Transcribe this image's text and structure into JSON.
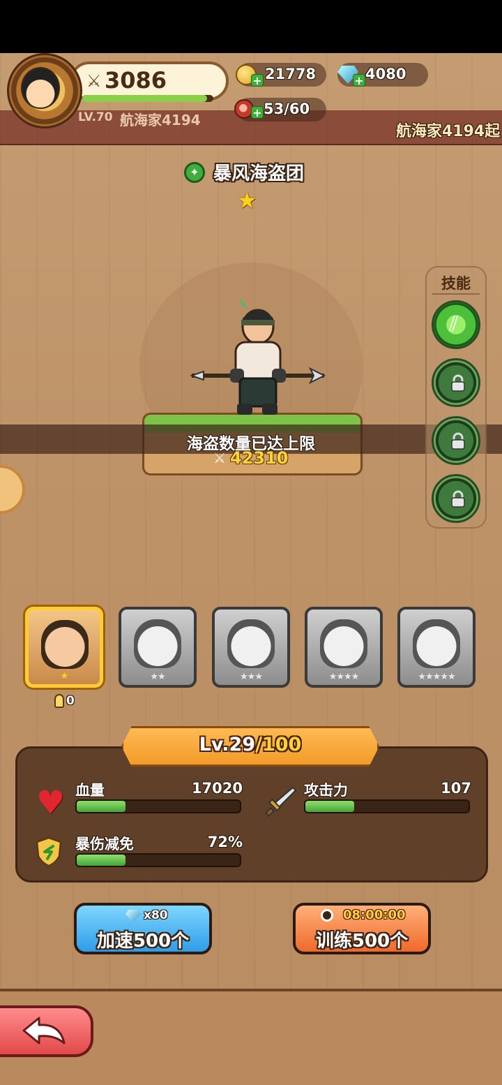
{
  "header": {
    "power": "3086",
    "power_progress_pct": 95,
    "player_level": "LV.70",
    "player_name": "航海家4194",
    "gold": "21778",
    "gems": "4080",
    "stamina": "53/60",
    "ticker": "航海家4194起"
  },
  "character": {
    "faction": "暴风海盗团",
    "stars": 1,
    "banner_message": "海盗数量已达上限",
    "troop_power": "42310"
  },
  "skills": {
    "title": "技能",
    "items": [
      {
        "name": "skill-1",
        "locked": false
      },
      {
        "name": "skill-2",
        "locked": true
      },
      {
        "name": "skill-3",
        "locked": true
      },
      {
        "name": "skill-4",
        "locked": true
      }
    ]
  },
  "roster": {
    "cards": [
      {
        "stars": "★",
        "selected": true
      },
      {
        "stars": "★★",
        "selected": false
      },
      {
        "stars": "★★★",
        "selected": false
      },
      {
        "stars": "★★★★",
        "selected": false
      },
      {
        "stars": "★★★★★",
        "selected": false
      }
    ],
    "owned_count": "0"
  },
  "level": {
    "prefix": "Lv.",
    "current": "29",
    "max": "/100"
  },
  "stats": {
    "hp_label": "血量",
    "hp_value": "17020",
    "hp_fill_pct": 30,
    "atk_label": "攻击力",
    "atk_value": "107",
    "atk_fill_pct": 30,
    "crit_label": "暴伤减免",
    "crit_value": "72%",
    "crit_fill_pct": 30
  },
  "actions": {
    "speedup_cost": "x80",
    "speedup_label": "加速500个",
    "train_timer": "08:00:00",
    "train_label": "训练500个"
  },
  "colors": {
    "background": "#bd9267",
    "accent_orange": "#f29b2a",
    "accent_blue": "#2f9de8",
    "bar_green": "#46a43a"
  }
}
